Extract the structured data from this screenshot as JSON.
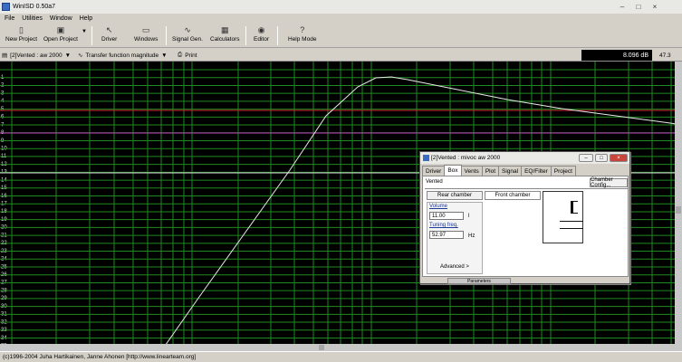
{
  "window": {
    "title": "WinISD 0.50a7"
  },
  "menu": [
    "File",
    "Utilities",
    "Window",
    "Help"
  ],
  "toolbar": {
    "new_project": "New Project",
    "open_project": "Open Project",
    "driver": "Driver",
    "windows": "Windows",
    "signal_gen": "Signal Gen.",
    "calculators": "Calculators",
    "editor": "Editor",
    "help_mode": "Help Mode"
  },
  "plotbar": {
    "project_select": "[2]Vented : aw 2000",
    "graph_select": "Transfer function magnitude",
    "print": "Print",
    "readout": "8.096 dB",
    "readout_right": "47.3"
  },
  "axis": {
    "y_ticks": [
      "1",
      "2",
      "3",
      "4",
      "5",
      "6",
      "7",
      "8",
      "9",
      "10",
      "11",
      "12",
      "13",
      "14",
      "15",
      "16",
      "17",
      "18",
      "19",
      "20",
      "21",
      "22",
      "23",
      "24",
      "25",
      "26",
      "27",
      "28",
      "29",
      "30",
      "31",
      "32",
      "33",
      "34",
      "35",
      "36"
    ]
  },
  "dialog": {
    "title": "[2]Vented : mivoc aw 2000",
    "tabs": [
      "Driver",
      "Box",
      "Vents",
      "Plot",
      "Signal",
      "EQ/Filter",
      "Project"
    ],
    "active_tab": "Box",
    "type_label": "Vented",
    "chamber_button": "Chamber Config...",
    "rear_chamber": "Rear chamber",
    "front_chamber": "Front chamber",
    "volume_label": "Volume",
    "volume_value": "11.00",
    "volume_unit": "l",
    "tuning_label": "Tuning freq.",
    "tuning_value": "52.97",
    "tuning_unit": "Hz",
    "advanced": "Advanced >",
    "footer": "Parameters"
  },
  "status": {
    "text": "(c)1996-2004 Juha Hartikainen, Janne Ahonen [http://www.linearteam.org]"
  },
  "colors": {
    "grid": "#1f8a1f",
    "curve": "#e8e8e8",
    "ref_line": "#d02030",
    "ref_line2": "#c040c0",
    "zero_line": "#e0e0e0"
  }
}
